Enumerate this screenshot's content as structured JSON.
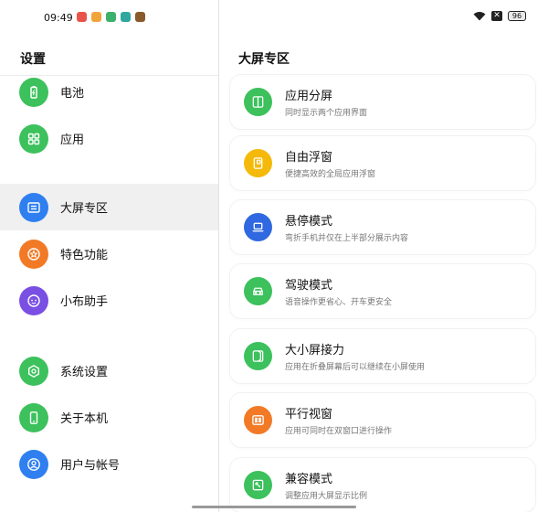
{
  "status": {
    "time": "09:49",
    "battery": "96",
    "app_icon_colors": [
      "#e9544a",
      "#f0a43a",
      "#3db06b",
      "#2fa7a0",
      "#8a5a2b"
    ]
  },
  "left": {
    "title": "设置",
    "items": [
      {
        "label": "电池",
        "icon": "battery-icon",
        "color": "#3cc15c"
      },
      {
        "label": "应用",
        "icon": "apps-grid-icon",
        "color": "#3cc15c"
      },
      {
        "label": "大屏专区",
        "icon": "large-screen-icon",
        "color": "#2f7ff0",
        "active": true
      },
      {
        "label": "特色功能",
        "icon": "star-icon",
        "color": "#f27a27"
      },
      {
        "label": "小布助手",
        "icon": "assistant-icon",
        "color": "#7a4fe3"
      },
      {
        "label": "系统设置",
        "icon": "settings-hex-icon",
        "color": "#3cc15c"
      },
      {
        "label": "关于本机",
        "icon": "phone-icon",
        "color": "#3cc15c"
      },
      {
        "label": "用户与帐号",
        "icon": "user-icon",
        "color": "#2f7ff0"
      }
    ]
  },
  "right": {
    "title": "大屏专区",
    "cards": [
      {
        "title": "应用分屏",
        "subtitle": "同时显示两个应用界面",
        "icon": "split-screen-icon",
        "color": "#3cc15c"
      },
      {
        "title": "自由浮窗",
        "subtitle": "便捷高效的全局应用浮窗",
        "icon": "floating-window-icon",
        "color": "#f5b90a"
      },
      {
        "title": "悬停模式",
        "subtitle": "弯折手机并仅在上半部分展示内容",
        "icon": "laptop-icon",
        "color": "#2f68e0"
      },
      {
        "title": "驾驶模式",
        "subtitle": "语音操作更省心、开车更安全",
        "icon": "car-icon",
        "color": "#3cc15c"
      },
      {
        "title": "大小屏接力",
        "subtitle": "应用在折叠屏幕后可以继续在小屏使用",
        "icon": "fold-relay-icon",
        "color": "#3cc15c"
      },
      {
        "title": "平行视窗",
        "subtitle": "应用可同时在双窗口进行操作",
        "icon": "parallel-window-icon",
        "color": "#f27a27"
      },
      {
        "title": "兼容模式",
        "subtitle": "调整应用大屏显示比例",
        "icon": "compatibility-icon",
        "color": "#3cc15c"
      }
    ]
  }
}
